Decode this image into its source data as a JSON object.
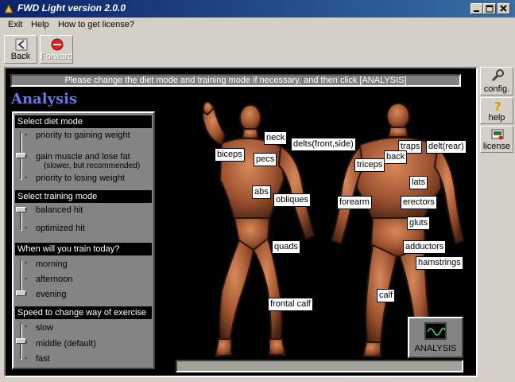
{
  "window": {
    "title": "FWD Light version 2.0.0"
  },
  "menu": {
    "items": [
      "Exit",
      "Help",
      "How to get license?"
    ]
  },
  "toolbar": {
    "back_label": "Back",
    "forward_label": "Forward"
  },
  "banner": {
    "text": "Please change the diet mode and training mode if necessary, and then click  [ANALYSIS]"
  },
  "heading": "Analysis",
  "settings": {
    "diet": {
      "title": "Select diet mode",
      "options": [
        "priority to gaining weight",
        "gain muscle and lose fat",
        "(slower, but recommended)",
        "priority to losing weight"
      ],
      "selected_index": 1
    },
    "training": {
      "title": "Select training mode",
      "options": [
        "balanced hit",
        "optimized hit"
      ],
      "selected_index": 0
    },
    "time": {
      "title": "When will you train today?",
      "options": [
        "morning",
        "afternoon",
        "evening"
      ],
      "selected_index": 2
    },
    "speed": {
      "title": "Speed to change way of exercise",
      "options": [
        "slow",
        "middle (default)",
        "fast"
      ],
      "selected_index": 1
    }
  },
  "muscles": {
    "front": [
      "neck",
      "delts(front,side)",
      "biceps",
      "pecs",
      "abs",
      "obliques",
      "quads",
      "frontal calf"
    ],
    "back": [
      "traps",
      "delt(rear)",
      "back",
      "triceps",
      "lats",
      "forearm",
      "erectors",
      "gluts",
      "adductors",
      "hamstrings",
      "calf"
    ]
  },
  "analysis_button": "ANALYSIS",
  "side": {
    "config_label": "config.",
    "help_label": "help",
    "license_label": "license"
  },
  "colors": {
    "titlebar": "#0a246a",
    "heading": "#6a78e8",
    "skin": "#a0522d"
  }
}
